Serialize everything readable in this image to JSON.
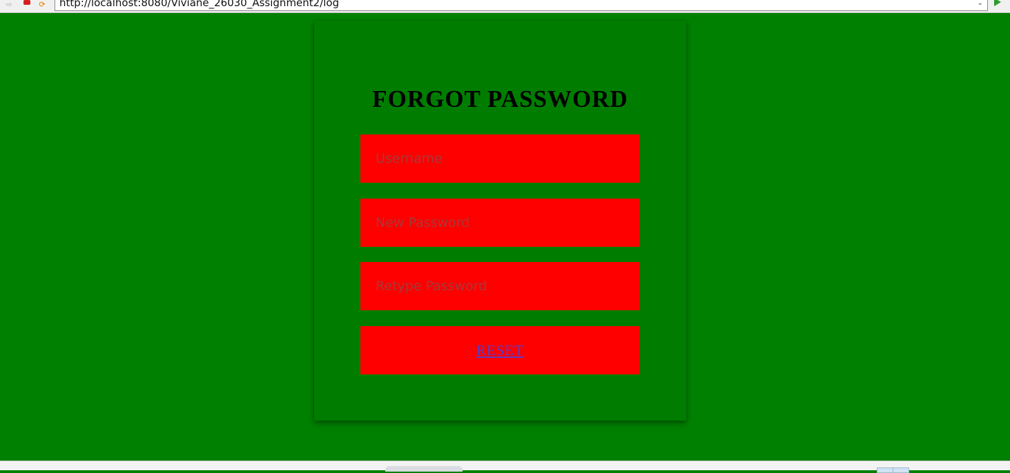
{
  "browser": {
    "url": "http://localhost:8080/Viviane_26030_Assignment2/log",
    "forward_icon": "arrow-forward-icon",
    "stop_icon": "stop-icon",
    "refresh_icon": "refresh-icon",
    "go_icon": "go-arrow-icon"
  },
  "form": {
    "title": "FORGOT PASSWORD",
    "username_placeholder": "Username",
    "new_password_placeholder": "New Password",
    "retype_password_placeholder": "Retype Password",
    "reset_label": "RESET"
  },
  "colors": {
    "background": "#008000",
    "card": "#007d00",
    "field": "#ff0000",
    "link": "#5a3cc8"
  }
}
